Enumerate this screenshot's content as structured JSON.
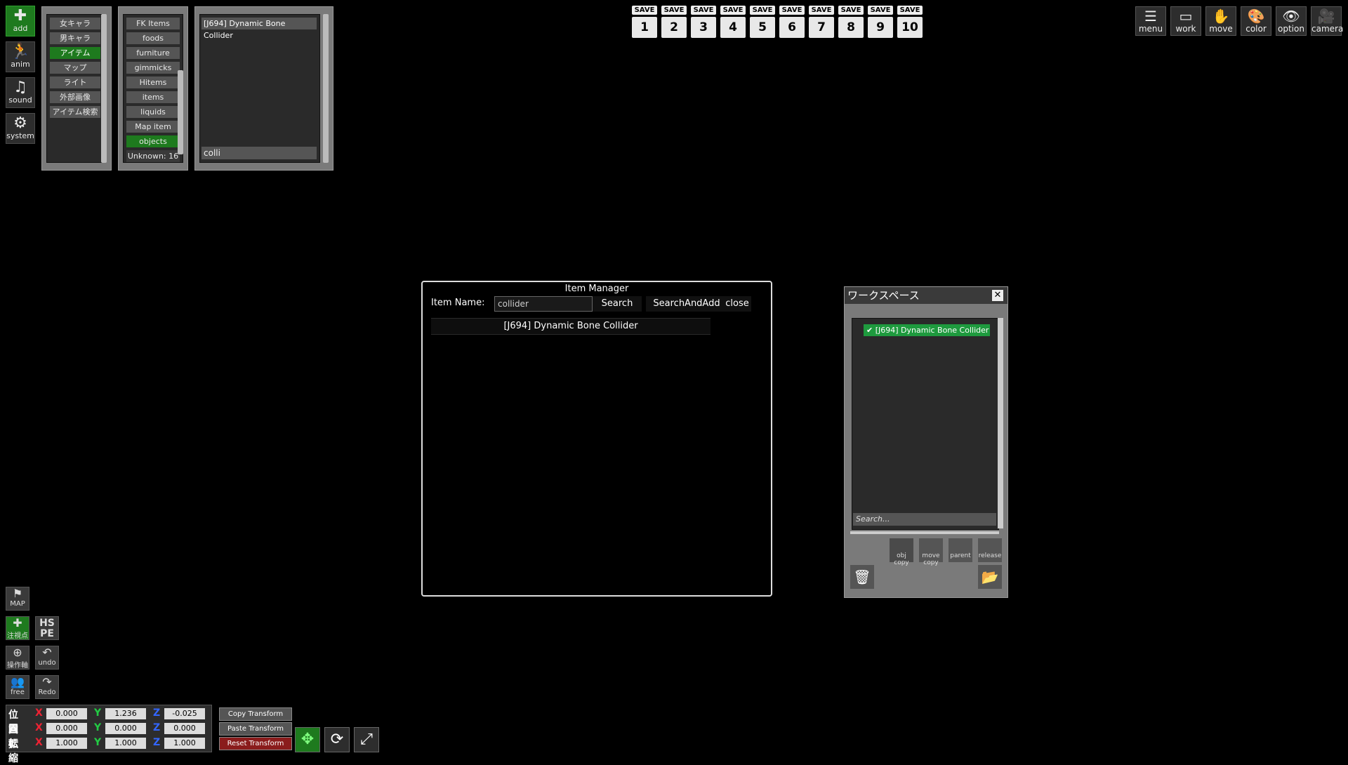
{
  "left_tools": [
    {
      "name": "add-tool",
      "glyph": "✚",
      "label": "add",
      "green": true
    },
    {
      "name": "anim-tool",
      "glyph": "🏃",
      "label": "anim",
      "green": false
    },
    {
      "name": "sound-tool",
      "glyph": "♫",
      "label": "sound",
      "green": false
    },
    {
      "name": "system-tool",
      "glyph": "⚙",
      "label": "system",
      "green": false
    }
  ],
  "categories": [
    "女キャラ",
    "男キャラ",
    "アイテム",
    "マップ",
    "ライト",
    "外部画像",
    "アイテム検索"
  ],
  "selected_category": "アイテム",
  "subcategories": [
    "FK Items",
    "foods",
    "furniture",
    "gimmicks",
    "Hitems",
    "items",
    "liquids",
    "Map item",
    "objects",
    "Unknown: 16"
  ],
  "selected_subcategory": "objects",
  "item_list": {
    "items": [
      "[J694] Dynamic Bone Collider"
    ],
    "filter": "colli"
  },
  "save_slots": [
    {
      "label": "SAVE",
      "number": "1"
    },
    {
      "label": "SAVE",
      "number": "2"
    },
    {
      "label": "SAVE",
      "number": "3"
    },
    {
      "label": "SAVE",
      "number": "4"
    },
    {
      "label": "SAVE",
      "number": "5"
    },
    {
      "label": "SAVE",
      "number": "6"
    },
    {
      "label": "SAVE",
      "number": "7"
    },
    {
      "label": "SAVE",
      "number": "8"
    },
    {
      "label": "SAVE",
      "number": "9"
    },
    {
      "label": "SAVE",
      "number": "10"
    }
  ],
  "right_tools": [
    {
      "name": "menu-tool",
      "glyph": "☰",
      "label": "menu"
    },
    {
      "name": "work-tool",
      "glyph": "▭",
      "label": "work"
    },
    {
      "name": "move-tool",
      "glyph": "✋",
      "label": "move"
    },
    {
      "name": "color-tool",
      "glyph": "🎨",
      "label": "color"
    },
    {
      "name": "option-tool",
      "glyph": "👁",
      "label": "option"
    },
    {
      "name": "camera-tool",
      "glyph": "🎥",
      "label": "camera"
    }
  ],
  "item_manager": {
    "title": "Item Manager",
    "item_name_label": "Item Name:",
    "input_value": "collider",
    "search_label": "Search",
    "search_add_label": "SearchAndAdd",
    "close_label": "close",
    "result": "[J694] Dynamic Bone Collider"
  },
  "workspace": {
    "title": "ワークスペース",
    "close_glyph": "✕",
    "entry": "✔ [J694] Dynamic Bone Collider",
    "search_placeholder": "Search...",
    "buttons": [
      "obj copy",
      "move copy",
      "parent",
      "release"
    ],
    "delete_glyph": "🗑",
    "folder_glyph": "📂"
  },
  "bottom_tools": {
    "map": {
      "glyph": "⚑",
      "label": "MAP"
    },
    "focus": {
      "glyph": "✚",
      "label": "注視点"
    },
    "hspe": {
      "label": "HS PE"
    },
    "axis": {
      "glyph": "⊕",
      "label": "操作軸"
    },
    "undo": {
      "glyph": "↶",
      "label": "undo"
    },
    "free": {
      "glyph": "👥",
      "label": "free"
    },
    "redo": {
      "glyph": "↷",
      "label": "Redo"
    }
  },
  "transform": {
    "rows": [
      {
        "label": "位置",
        "x": "0.000",
        "y": "1.236",
        "z": "-0.025"
      },
      {
        "label": "回転",
        "x": "0.000",
        "y": "0.000",
        "z": "0.000"
      },
      {
        "label": "拡縮",
        "x": "1.000",
        "y": "1.000",
        "z": "1.000"
      }
    ],
    "axes": {
      "x": "X",
      "y": "Y",
      "z": "Z"
    },
    "copy_label": "Copy Transform",
    "paste_label": "Paste Transform",
    "reset_label": "Reset Transform"
  },
  "gizmos": [
    {
      "name": "move-gizmo-icon",
      "glyph": "✥",
      "active": true
    },
    {
      "name": "rotate-gizmo-icon",
      "glyph": "⟳",
      "active": false
    },
    {
      "name": "scale-gizmo-icon",
      "glyph": "⤢",
      "active": false
    }
  ]
}
